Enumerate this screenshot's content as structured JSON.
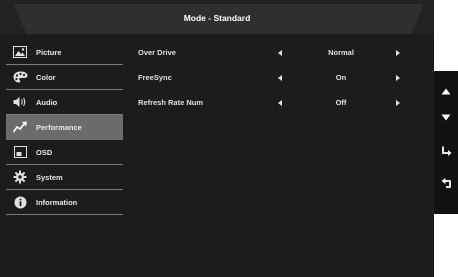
{
  "header": {
    "title": "Mode - Standard"
  },
  "sidebar": {
    "items": [
      {
        "label": "Picture",
        "icon": "picture-icon"
      },
      {
        "label": "Color",
        "icon": "palette-icon"
      },
      {
        "label": "Audio",
        "icon": "speaker-icon"
      },
      {
        "label": "Performance",
        "icon": "performance-icon",
        "selected": true
      },
      {
        "label": "OSD",
        "icon": "osd-icon"
      },
      {
        "label": "System",
        "icon": "gear-icon"
      },
      {
        "label": "Information",
        "icon": "info-icon"
      }
    ]
  },
  "settings": [
    {
      "label": "Over Drive",
      "value": "Normal"
    },
    {
      "label": "FreeSync",
      "value": "On"
    },
    {
      "label": "Refresh Rate Num",
      "value": "Off"
    }
  ],
  "keys": [
    {
      "name": "up-key",
      "icon": "triangle-up-icon"
    },
    {
      "name": "down-key",
      "icon": "triangle-down-icon"
    },
    {
      "name": "enter-key",
      "icon": "enter-arrow-icon"
    },
    {
      "name": "back-key",
      "icon": "return-arrow-icon"
    }
  ],
  "colors": {
    "background": "#1c1c1c",
    "selected": "#6b6b6b",
    "title_bar": "#2f2f2f"
  }
}
